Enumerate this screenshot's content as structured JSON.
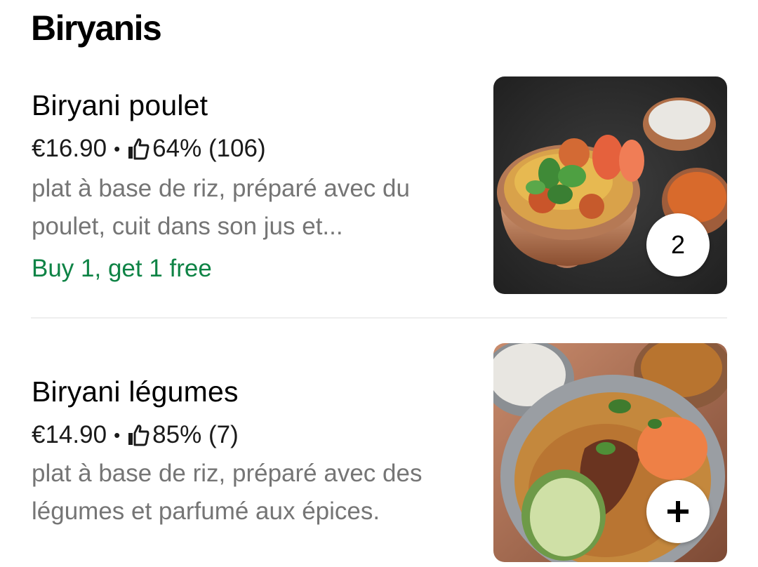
{
  "section": {
    "title": "Biryanis"
  },
  "items": [
    {
      "name": "Biryani poulet",
      "price": "€16.90",
      "separator": "•",
      "rating": "64% (106)",
      "description_lines": [
        "plat à base de riz, préparé avec du",
        "poulet, cuit dans son jus et..."
      ],
      "promo": "Buy 1, get 1 free",
      "quantity": "2",
      "image_icon": "chicken-biryani-photo"
    },
    {
      "name": "Biryani légumes",
      "price": "€14.90",
      "separator": "•",
      "rating": "85% (7)",
      "description_lines": [
        "plat à base de riz, préparé avec des",
        "légumes et parfumé aux épices."
      ],
      "add_label": "+",
      "image_icon": "vegetable-biryani-photo"
    }
  ],
  "colors": {
    "promo": "#0e8345",
    "muted_text": "#757575",
    "divider": "#eeeeee"
  }
}
